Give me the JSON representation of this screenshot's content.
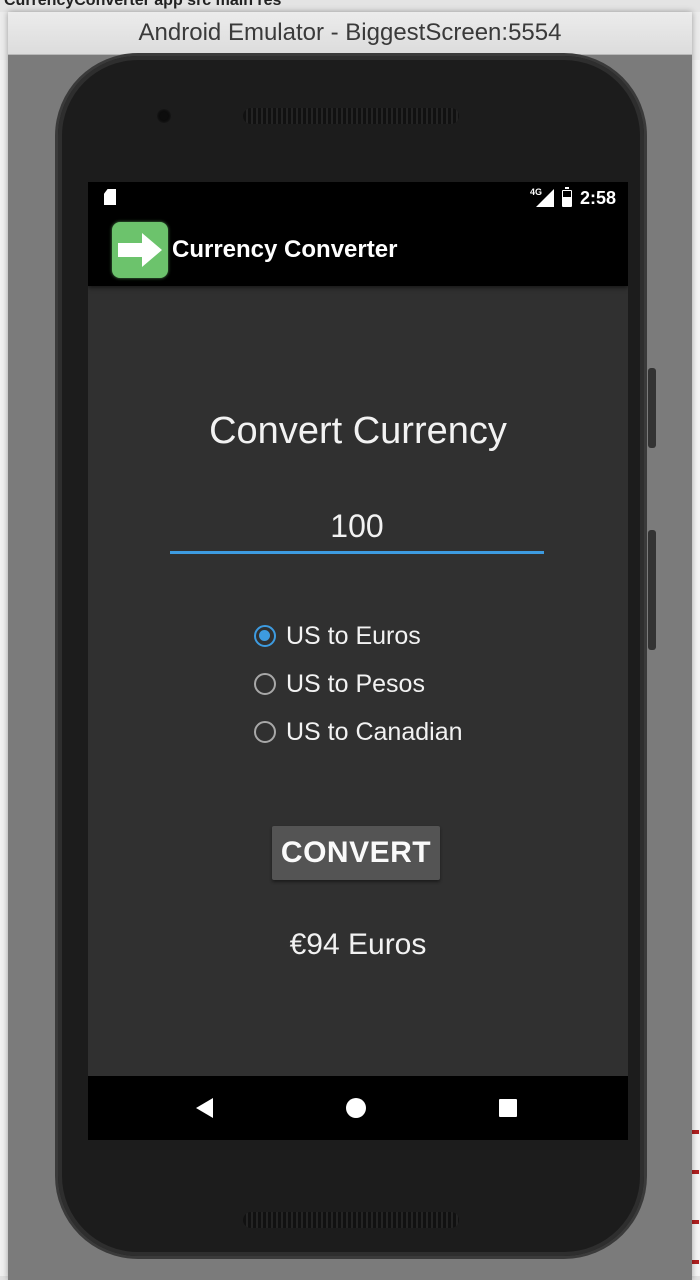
{
  "ide": {
    "top_text": "CurrencyConverter  app  src  main  res"
  },
  "window": {
    "title": "Android Emulator - BiggestScreen:5554"
  },
  "status_bar": {
    "network_label": "4G",
    "time": "2:58"
  },
  "app_bar": {
    "title": "Currency Converter",
    "icon": "arrow-right-icon"
  },
  "main": {
    "heading": "Convert Currency",
    "amount_value": "100",
    "options": [
      {
        "label": "US to Euros",
        "checked": true
      },
      {
        "label": "US to Pesos",
        "checked": false
      },
      {
        "label": "US to Canadian",
        "checked": false
      }
    ],
    "convert_label": "CONVERT",
    "result": "€94 Euros"
  },
  "nav_bar": {
    "back_icon": "back-triangle-icon",
    "home_icon": "home-circle-icon",
    "recent_icon": "recent-apps-square-icon"
  },
  "colors": {
    "accent": "#3d9be0",
    "screen_bg": "#303030",
    "app_icon_bg": "#6cc36c",
    "button_bg": "#545454"
  }
}
